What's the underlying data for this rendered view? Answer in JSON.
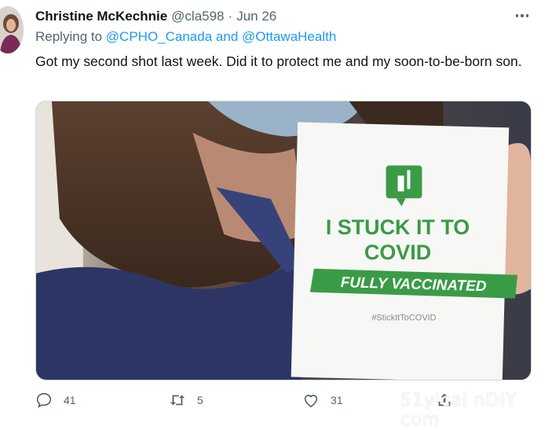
{
  "tweet": {
    "author_name": "Christine McKechnie",
    "handle": "@cla598",
    "separator": "·",
    "date": "Jun 26",
    "replying_prefix": "Replying to",
    "mention_1": "@CPHO_Canada",
    "mention_joiner": "and",
    "mention_2": "@OttawaHealth",
    "text": "Got my second shot last week. Did it to protect me and my soon-to-be-born son."
  },
  "sticker": {
    "line1": "I STUCK IT TO",
    "line2": "COVID",
    "banner": "FULLY VACCINATED",
    "hashtag": "#StickItToCOVID"
  },
  "actions": {
    "replies": "41",
    "retweets": "5",
    "likes": "31"
  },
  "watermark": "51yicai nDIY com",
  "icons": [
    "ellipsis-icon",
    "reply-icon",
    "retweet-icon",
    "heart-icon",
    "share-icon",
    "vaccine-icon"
  ],
  "colors": {
    "accent": "#1d9bf0",
    "sticker_green": "#3a9b46"
  }
}
